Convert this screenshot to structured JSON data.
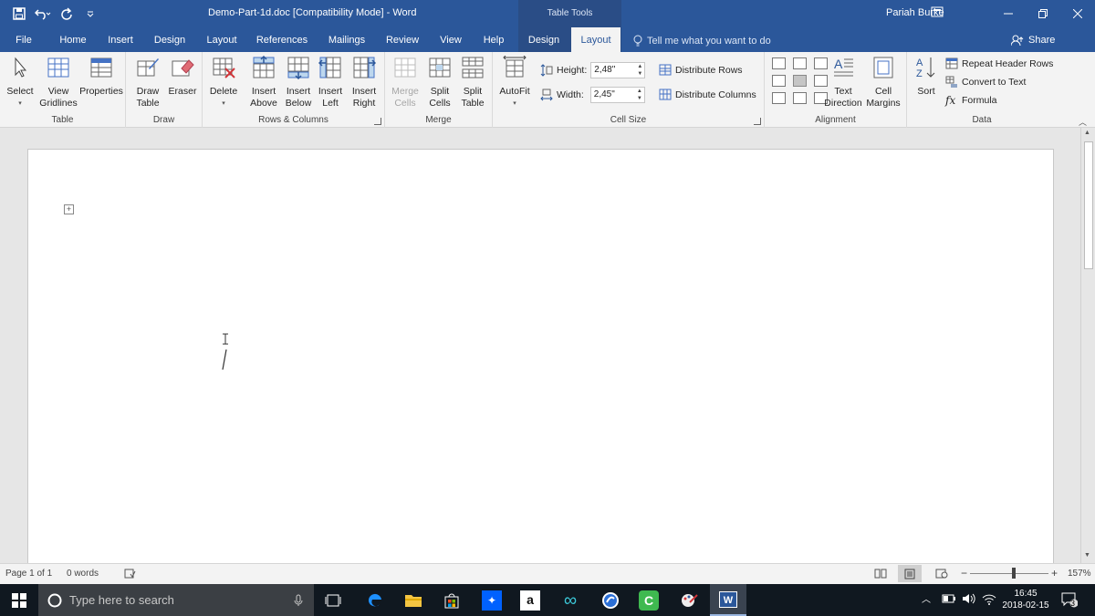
{
  "window": {
    "doc_title": "Demo-Part-1d.doc [Compatibility Mode]  -  Word",
    "context_header": "Table Tools",
    "user_name": "Pariah Burke"
  },
  "tabs": [
    {
      "label": "File"
    },
    {
      "label": "Home"
    },
    {
      "label": "Insert"
    },
    {
      "label": "Design"
    },
    {
      "label": "Layout"
    },
    {
      "label": "References"
    },
    {
      "label": "Mailings"
    },
    {
      "label": "Review"
    },
    {
      "label": "View"
    },
    {
      "label": "Help"
    },
    {
      "label": "Design"
    },
    {
      "label": "Layout"
    }
  ],
  "tell_me": "Tell me what you want to do",
  "share": "Share",
  "ribbon": {
    "table": {
      "label": "Table",
      "select": "Select",
      "view_gridlines": [
        "View",
        "Gridlines"
      ],
      "properties": "Properties"
    },
    "draw": {
      "label": "Draw",
      "draw_table": [
        "Draw",
        "Table"
      ],
      "eraser": "Eraser"
    },
    "rows_columns": {
      "label": "Rows & Columns",
      "delete": "Delete",
      "insert_above": [
        "Insert",
        "Above"
      ],
      "insert_below": [
        "Insert",
        "Below"
      ],
      "insert_left": [
        "Insert",
        "Left"
      ],
      "insert_right": [
        "Insert",
        "Right"
      ]
    },
    "merge": {
      "label": "Merge",
      "merge_cells": [
        "Merge",
        "Cells"
      ],
      "split_cells": [
        "Split",
        "Cells"
      ],
      "split_table": [
        "Split",
        "Table"
      ]
    },
    "cell_size": {
      "label": "Cell Size",
      "autofit": "AutoFit",
      "height_label": "Height:",
      "height_value": "2,48\"",
      "width_label": "Width:",
      "width_value": "2,45\"",
      "distribute_rows": "Distribute Rows",
      "distribute_columns": "Distribute Columns"
    },
    "alignment": {
      "label": "Alignment",
      "text_direction": [
        "Text",
        "Direction"
      ],
      "cell_margins": [
        "Cell",
        "Margins"
      ]
    },
    "data": {
      "label": "Data",
      "sort": "Sort",
      "repeat_header_rows": "Repeat Header Rows",
      "convert_to_text": "Convert to Text",
      "formula": "Formula"
    }
  },
  "status": {
    "page": "Page 1 of 1",
    "words": "0 words",
    "zoom": "157%"
  },
  "taskbar": {
    "search_placeholder": "Type here to search",
    "time": "16:45",
    "date": "2018-02-15",
    "notifications": "3"
  }
}
